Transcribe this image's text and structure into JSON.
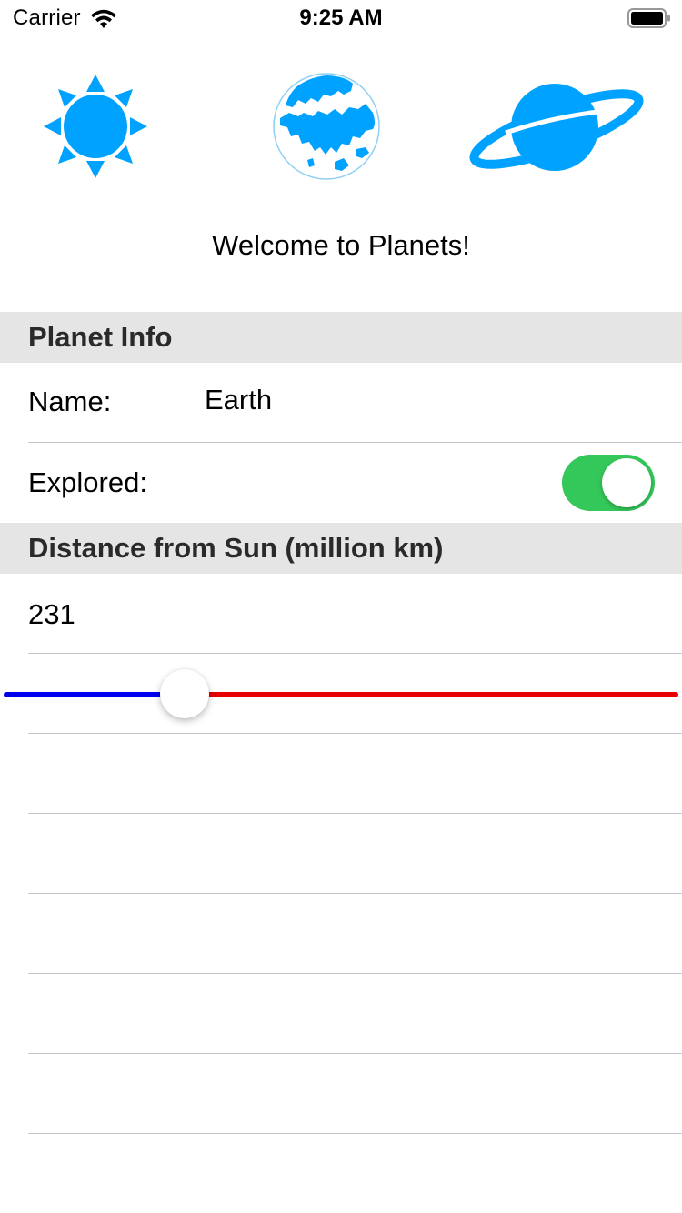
{
  "status_bar": {
    "carrier": "Carrier",
    "time": "9:25 AM"
  },
  "icons": {
    "sun": "sun-icon",
    "earth": "earth-icon",
    "saturn": "saturn-icon",
    "accent_color": "#00a2ff"
  },
  "welcome_text": "Welcome to Planets!",
  "planet_info": {
    "header": "Planet Info",
    "name_label": "Name:",
    "name_value": "Earth",
    "explored_label": "Explored:",
    "explored_on": true,
    "toggle_color": "#34c759"
  },
  "distance": {
    "header": "Distance from Sun (million km)",
    "value": "231",
    "slider_fraction": 0.25,
    "min_track_color": "#0000ee",
    "max_track_color": "#e60000"
  }
}
